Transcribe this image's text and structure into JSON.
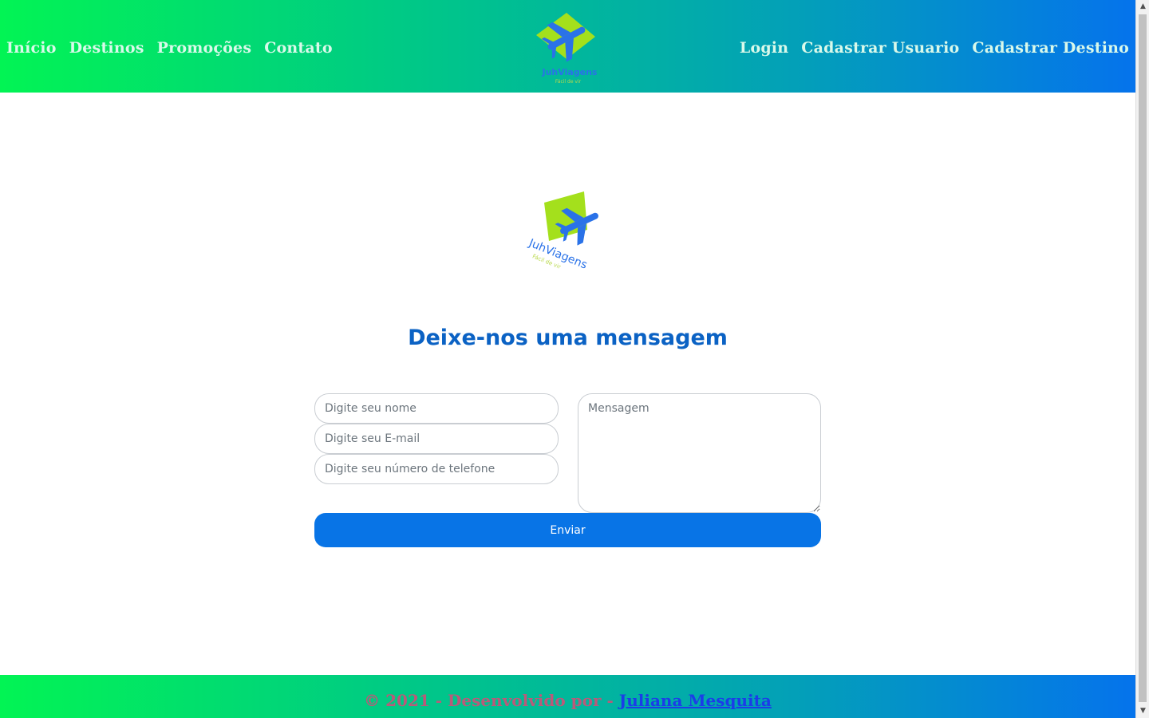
{
  "nav": {
    "left": [
      "Início",
      "Destinos",
      "Promoções",
      "Contato"
    ],
    "right": [
      "Login",
      "Cadastrar Usuario",
      "Cadastrar Destino"
    ]
  },
  "brand": {
    "name": "JuhViagens",
    "tagline": "Fácil de vir",
    "icon": "airplane-icon"
  },
  "contact": {
    "title": "Deixe-nos uma mensagem",
    "name_placeholder": "Digite seu nome",
    "email_placeholder": "Digite seu E-mail",
    "phone_placeholder": "Digite seu número de telefone",
    "message_placeholder": "Mensagem",
    "submit_label": "Enviar"
  },
  "footer": {
    "text": "© 2021 - Desenvolvido por - ",
    "author": "Juliana Mesquita"
  },
  "colors": {
    "gradient_start": "#02f454",
    "gradient_end": "#0573ec",
    "title": "#0b62c4",
    "button": "#0874e6",
    "logo_diamond": "#a4e01c",
    "logo_plane": "#2a72e8",
    "footer_text": "#b95a7a"
  }
}
